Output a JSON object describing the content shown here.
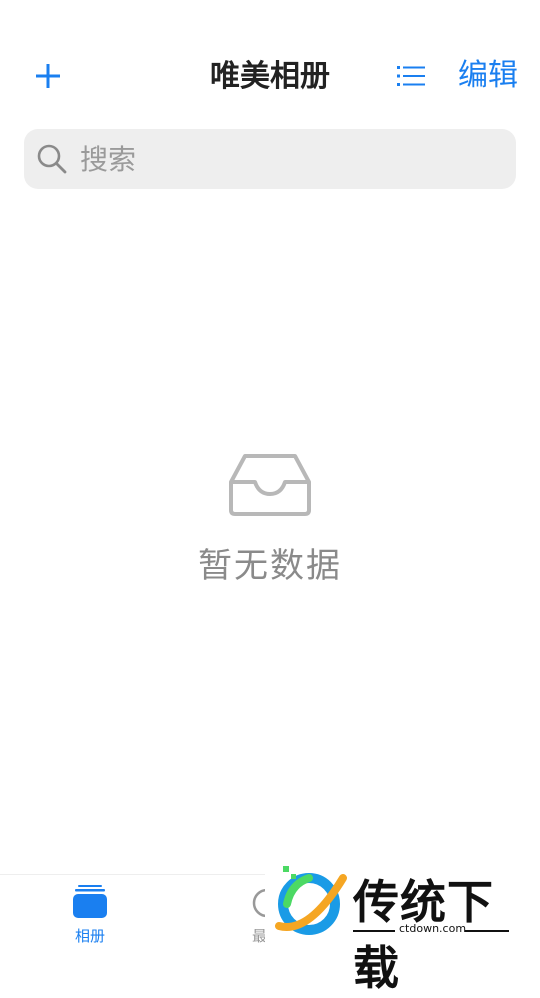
{
  "header": {
    "title": "唯美相册",
    "edit_label": "编辑"
  },
  "search": {
    "placeholder": "搜索"
  },
  "empty_state": {
    "message": "暂无数据"
  },
  "tabbar": {
    "tabs": [
      {
        "label": "相册",
        "active": true
      },
      {
        "label": "最近",
        "active": false
      }
    ]
  },
  "watermark": {
    "brand": "传统下载",
    "url": "ctdown.com"
  },
  "colors": {
    "accent": "#1a7ff0",
    "empty_gray": "#8a8a8a",
    "search_bg": "#eeeeee"
  },
  "icons": [
    "plus-icon",
    "list-icon",
    "search-icon",
    "inbox-icon",
    "album-stack-icon",
    "recent-icon"
  ]
}
